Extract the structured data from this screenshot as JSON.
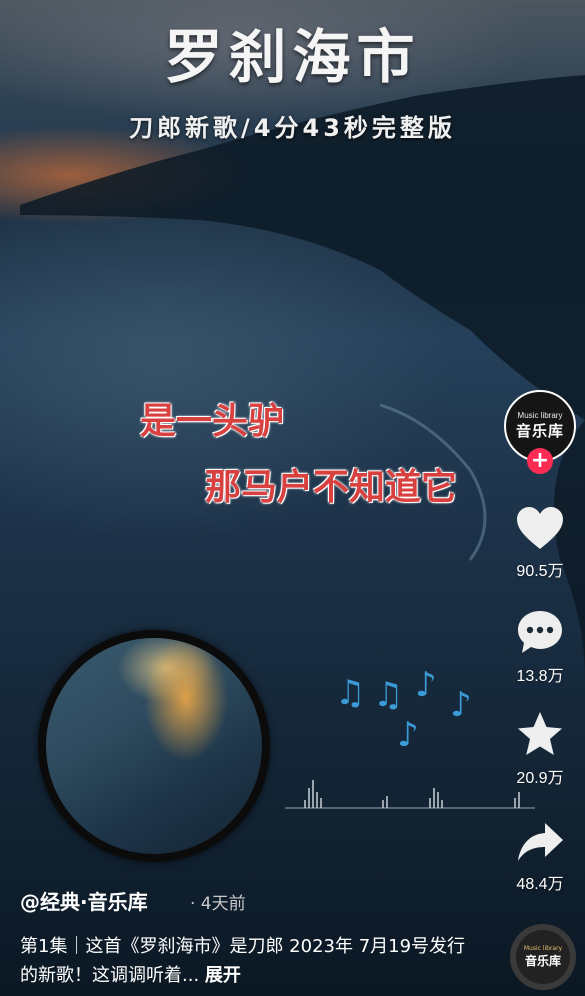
{
  "video": {
    "title": "罗刹海市",
    "subtitle": "刀郎新歌/4分43秒完整版",
    "lyrics": [
      "是一头驴",
      "那马户不知道它"
    ]
  },
  "creator": {
    "avatar_text_small": "Music library",
    "avatar_text_big": "音乐库",
    "follow_symbol": "+"
  },
  "actions": {
    "likes": "90.5万",
    "comments": "13.8万",
    "favorites": "20.9万",
    "shares": "48.4万"
  },
  "info": {
    "author": "@经典·音乐库",
    "time": "· 4天前",
    "description": "第1集｜这首《罗刹海市》是刀郎 2023年 7月19号发行的新歌！这调调听着... ",
    "expand": "展开"
  },
  "music_disc": {
    "small": "Music library",
    "big": "音乐库"
  },
  "icons": {
    "like": "heart-icon",
    "comment": "comment-bubble-icon",
    "favorite": "star-icon",
    "share": "share-arrow-icon",
    "notes": "music-note-icon"
  },
  "colors": {
    "lyric": "#d94040",
    "follow": "#fe2c55",
    "notes": "#3b9bd6"
  }
}
